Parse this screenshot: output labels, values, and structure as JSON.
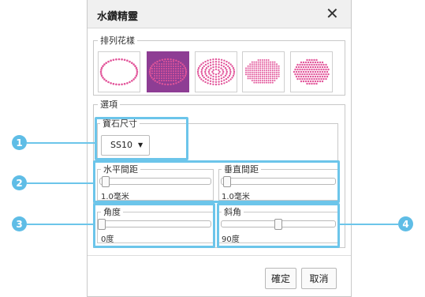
{
  "dialog": {
    "title": "水鑽精靈",
    "close_label": "✕"
  },
  "patterns": {
    "label": "排列花樣",
    "items": [
      {
        "name": "outline-oval"
      },
      {
        "name": "filled-oval-grid",
        "selected": true
      },
      {
        "name": "filled-oval-rings"
      },
      {
        "name": "filled-oval-dense"
      },
      {
        "name": "filled-oval-rows"
      }
    ]
  },
  "options": {
    "label": "選項",
    "stone_size": {
      "label": "寶石尺寸",
      "value": "SS10"
    },
    "h_spacing": {
      "label": "水平間距",
      "value": "1.0毫米",
      "fraction": 0.02
    },
    "v_spacing": {
      "label": "垂直間距",
      "value": "1.0毫米",
      "fraction": 0.02
    },
    "angle": {
      "label": "角度",
      "value": "0度",
      "fraction": 0.0
    },
    "skew": {
      "label": "斜角",
      "value": "90度",
      "fraction": 0.5
    }
  },
  "buttons": {
    "ok": "確定",
    "cancel": "取消"
  },
  "callouts": [
    "1",
    "2",
    "3",
    "4"
  ],
  "colors": {
    "accent": "#8e3d94",
    "dot": "#e2559a",
    "highlight": "#6cc5ea",
    "badge": "#5fbde6"
  }
}
